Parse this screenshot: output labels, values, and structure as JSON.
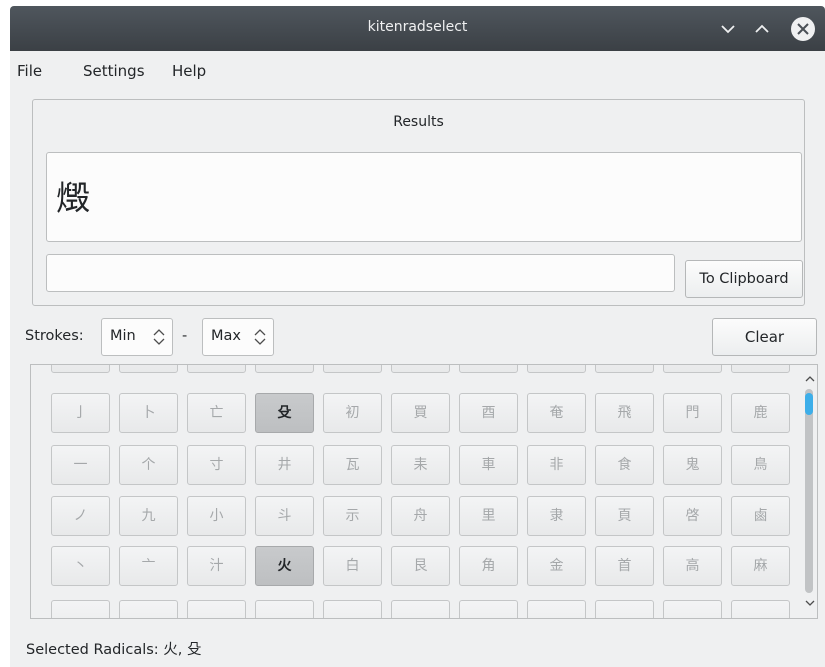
{
  "window": {
    "title": "kitenradselect"
  },
  "menu": [
    {
      "label": "File"
    },
    {
      "label": "Settings"
    },
    {
      "label": "Help"
    }
  ],
  "results": {
    "title": "Results",
    "kanji": [
      "燬"
    ],
    "input_value": "",
    "clipboard_button": "To Clipboard"
  },
  "strokes": {
    "label": "Strokes:",
    "min": "Min",
    "separator": "-",
    "max": "Max",
    "clear_button": "Clear"
  },
  "radicals": {
    "rows": [
      [
        "",
        "",
        "",
        "",
        "",
        "",
        "",
        "",
        "",
        "",
        ""
      ],
      [
        "亅",
        "卜",
        "亡",
        "殳",
        "初",
        "買",
        "酉",
        "奄",
        "飛",
        "門",
        "鹿"
      ],
      [
        "一",
        "个",
        "寸",
        "井",
        "瓦",
        "耒",
        "車",
        "非",
        "食",
        "鬼",
        "鳥"
      ],
      [
        "ノ",
        "九",
        "小",
        "斗",
        "示",
        "舟",
        "里",
        "隶",
        "頁",
        "啓",
        "鹵"
      ],
      [
        "丶",
        "亠",
        "汁",
        "火",
        "白",
        "艮",
        "角",
        "金",
        "首",
        "高",
        "麻"
      ],
      [
        "",
        "",
        "",
        "",
        "",
        "",
        "",
        "",
        "",
        "",
        ""
      ]
    ],
    "selected": [
      "殳",
      "火"
    ]
  },
  "status": {
    "selected_text": "Selected Radicals: 火, 殳"
  },
  "colors": {
    "accent": "#3daee9",
    "titlebar": "#474c51",
    "background": "#eff0f1",
    "selected_radical": "#c3c5c7"
  },
  "icons": [
    "minimize-icon",
    "maximize-icon",
    "close-icon",
    "spin-arrows-icon",
    "scroll-up-icon",
    "scroll-down-icon"
  ]
}
